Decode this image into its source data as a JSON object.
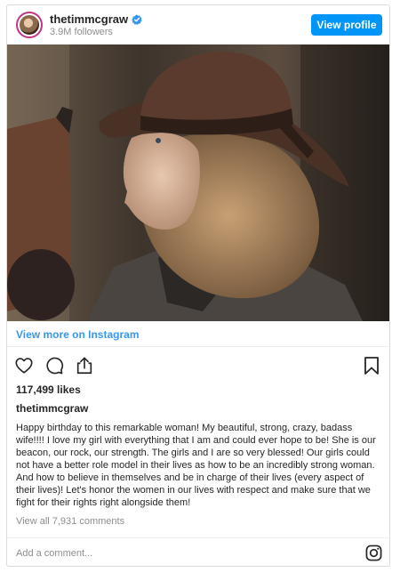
{
  "header": {
    "username": "thetimmcgraw",
    "followers": "3.9M followers",
    "view_profile_label": "View profile"
  },
  "photo": {
    "icon": "photo-woman-in-hat"
  },
  "view_more_label": "View more on Instagram",
  "actions": {
    "like_icon": "heart-icon",
    "comment_icon": "comment-icon",
    "share_icon": "share-icon",
    "save_icon": "bookmark-icon"
  },
  "likes": "117,499 likes",
  "caption_user": "thetimmcgraw",
  "caption": "Happy birthday to this remarkable woman! My beautiful, strong, crazy, badass wife!!!! I love my girl with everything that I am and could ever hope to be! She is our beacon, our rock, our strength. The girls and I are so very blessed! Our girls could not have a better role model in their lives as how to be an incredibly strong woman. And how to believe in themselves and be in charge of their lives (every aspect of their lives)! Let's honor the women in our lives with respect and make sure that we fight for their rights right alongside them!",
  "comments_link": "View all 7,931 comments",
  "comment_input": {
    "placeholder": "Add a comment...",
    "value": ""
  },
  "colors": {
    "accent": "#0095f6",
    "link": "#3897f0",
    "muted": "#8e8e8e",
    "text": "#262626"
  }
}
